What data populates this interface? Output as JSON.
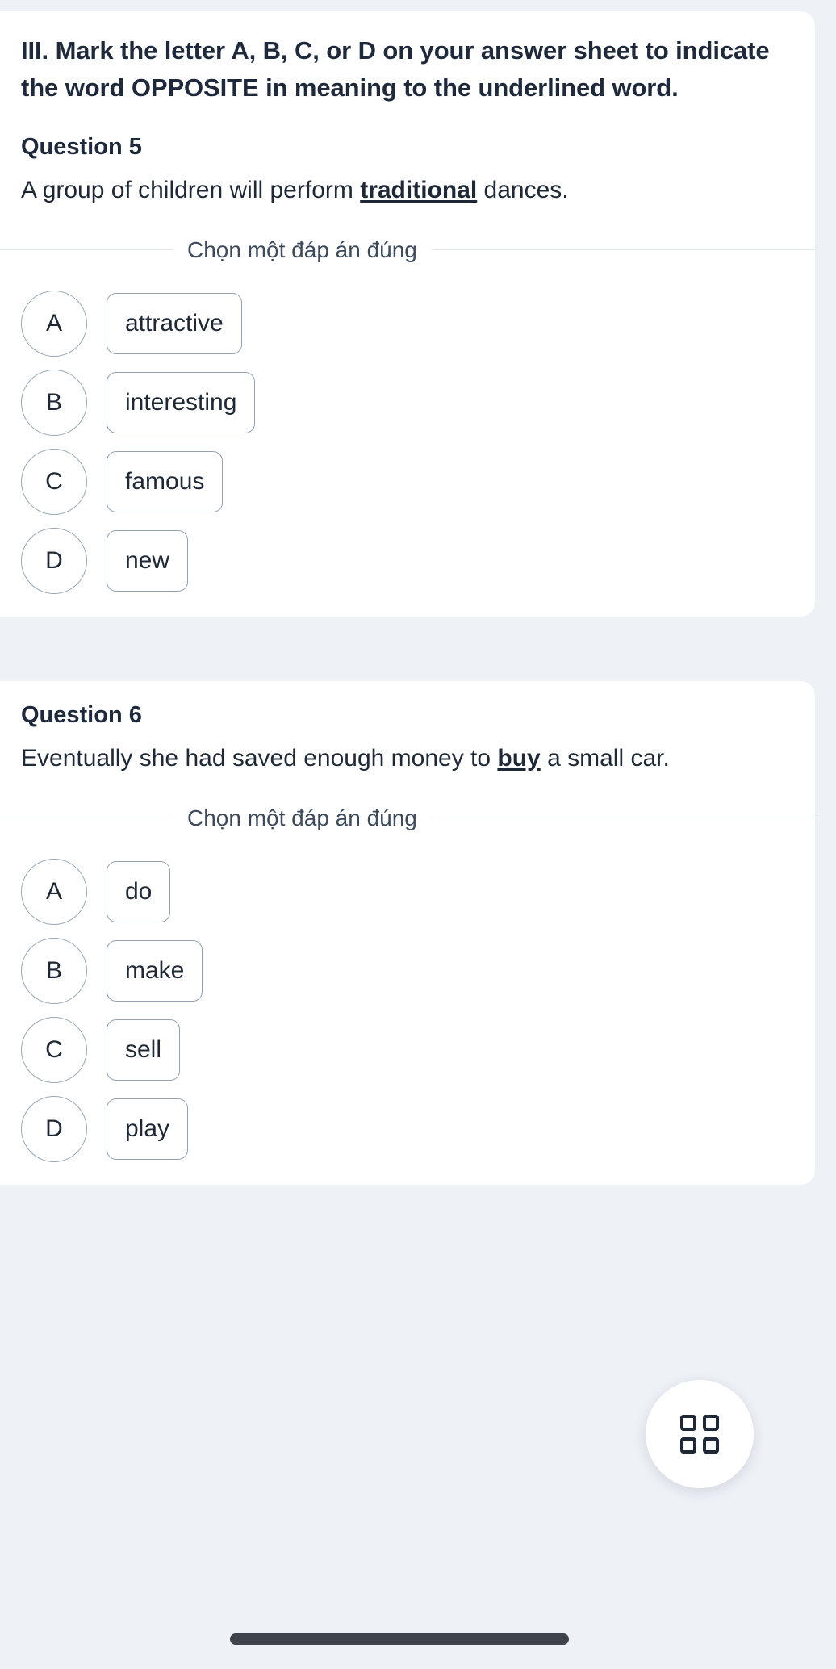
{
  "instruction": {
    "text": "III. Mark the letter A, B, C, or D on your answer sheet to indicate the word OPPOSITE in meaning to the underlined word."
  },
  "divider_caption": "Chọn một đáp án đúng",
  "colors": {
    "page_background": "#eef1f6",
    "card_background": "#ffffff",
    "text_primary": "#1e2836",
    "heading": "#1e293b",
    "option_border": "#94a3b3",
    "divider_rule": "#e2e6ed",
    "home_indicator": "#3f434a",
    "icon": "#1e2836"
  },
  "questions": [
    {
      "label": "Question 5",
      "stem_before": "A group of children will perform ",
      "stem_underlined": "traditional",
      "stem_after": " dances.",
      "options": [
        {
          "letter": "A",
          "text": "attractive"
        },
        {
          "letter": "B",
          "text": "interesting"
        },
        {
          "letter": "C",
          "text": "famous"
        },
        {
          "letter": "D",
          "text": "new"
        }
      ]
    },
    {
      "label": "Question 6",
      "stem_before": "Eventually she had saved enough money to ",
      "stem_underlined": "buy",
      "stem_after": " a small car.",
      "options": [
        {
          "letter": "A",
          "text": "do"
        },
        {
          "letter": "B",
          "text": "make"
        },
        {
          "letter": "C",
          "text": "sell"
        },
        {
          "letter": "D",
          "text": "play"
        }
      ]
    }
  ],
  "fab": {
    "icon": "grid-2x2-icon"
  }
}
